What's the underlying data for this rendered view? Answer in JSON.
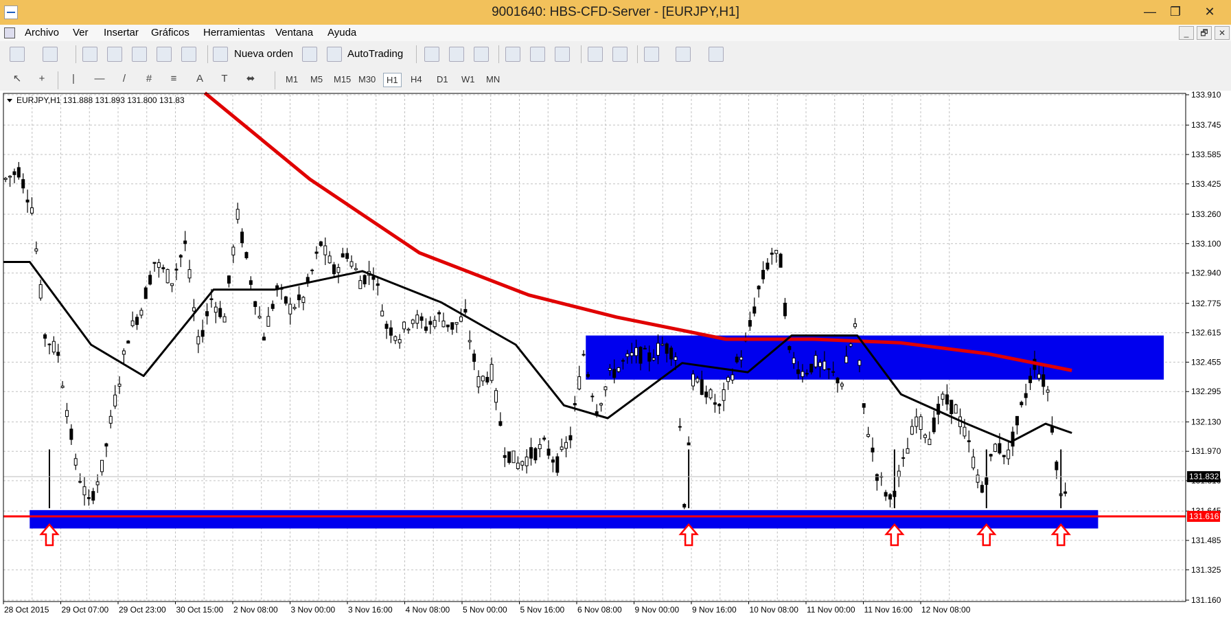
{
  "window": {
    "title": "9001640: HBS-CFD-Server - [EURJPY,H1]",
    "minimize": "—",
    "maximize": "❐",
    "close": "✕"
  },
  "menu": [
    "Archivo",
    "Ver",
    "Insertar",
    "Gráficos",
    "Herramientas",
    "Ventana",
    "Ayuda"
  ],
  "mdi": {
    "minimize": "_",
    "restore": "🗗",
    "close": "✕"
  },
  "toolbar": {
    "new_order": "Nueva orden",
    "autotrading": "AutoTrading",
    "search_placeholder": "",
    "search_icon": "🔍",
    "help_icon": "💬"
  },
  "drawing_tools": [
    "↖",
    "+",
    "|",
    "—",
    "/",
    "#",
    "≡",
    "A",
    "T",
    "⬌"
  ],
  "timeframes": [
    "M1",
    "M5",
    "M15",
    "M30",
    "H1",
    "H4",
    "D1",
    "W1",
    "MN"
  ],
  "active_timeframe": "H1",
  "colors": {
    "candles": "#000000",
    "ma_fast": "#000000",
    "ma_slow": "#e00000",
    "zone": "#0000ee",
    "support_line": "#ff0000",
    "grid": "#c0c0c0",
    "arrow": "#ff0000",
    "price_label_bg": "#000000",
    "line_label_bg": "#ff0000"
  },
  "chart_data": {
    "type": "candlestick",
    "header": "EURJPY,H1  131.888 131.893 131.800 131.83",
    "price_axis": [
      "133.910",
      "133.745",
      "133.585",
      "133.425",
      "133.260",
      "133.100",
      "132.940",
      "132.775",
      "132.615",
      "132.455",
      "132.295",
      "132.130",
      "131.970",
      "131.810",
      "131.645",
      "131.485",
      "131.325",
      "131.160"
    ],
    "ylim": [
      131.16,
      133.91
    ],
    "time_axis": [
      "28 Oct 2015",
      "29 Oct 07:00",
      "29 Oct 23:00",
      "30 Oct 15:00",
      "2 Nov 08:00",
      "3 Nov 00:00",
      "3 Nov 16:00",
      "4 Nov 08:00",
      "5 Nov 00:00",
      "5 Nov 16:00",
      "6 Nov 08:00",
      "9 Nov 00:00",
      "9 Nov 16:00",
      "10 Nov 08:00",
      "11 Nov 00:00",
      "11 Nov 16:00",
      "12 Nov 08:00"
    ],
    "current_price": "131.832",
    "support_price": "131.616",
    "price_series": [
      {
        "t": 0,
        "p": 133.45
      },
      {
        "t": 3,
        "p": 133.5
      },
      {
        "t": 6,
        "p": 133.3
      },
      {
        "t": 9,
        "p": 132.6
      },
      {
        "t": 12,
        "p": 132.5
      },
      {
        "t": 16,
        "p": 131.9
      },
      {
        "t": 19,
        "p": 131.68
      },
      {
        "t": 22,
        "p": 131.88
      },
      {
        "t": 25,
        "p": 132.25
      },
      {
        "t": 28,
        "p": 132.6
      },
      {
        "t": 31,
        "p": 132.75
      },
      {
        "t": 34,
        "p": 133.0
      },
      {
        "t": 38,
        "p": 132.9
      },
      {
        "t": 41,
        "p": 133.1
      },
      {
        "t": 44,
        "p": 132.55
      },
      {
        "t": 47,
        "p": 132.8
      },
      {
        "t": 50,
        "p": 132.7
      },
      {
        "t": 53,
        "p": 133.25
      },
      {
        "t": 56,
        "p": 132.9
      },
      {
        "t": 59,
        "p": 132.6
      },
      {
        "t": 62,
        "p": 132.85
      },
      {
        "t": 65,
        "p": 132.75
      },
      {
        "t": 68,
        "p": 132.8
      },
      {
        "t": 72,
        "p": 133.1
      },
      {
        "t": 75,
        "p": 132.95
      },
      {
        "t": 78,
        "p": 133.05
      },
      {
        "t": 81,
        "p": 132.9
      },
      {
        "t": 84,
        "p": 132.95
      },
      {
        "t": 87,
        "p": 132.65
      },
      {
        "t": 90,
        "p": 132.6
      },
      {
        "t": 93,
        "p": 132.7
      },
      {
        "t": 96,
        "p": 132.65
      },
      {
        "t": 99,
        "p": 132.7
      },
      {
        "t": 102,
        "p": 132.65
      },
      {
        "t": 105,
        "p": 132.7
      },
      {
        "t": 108,
        "p": 132.35
      },
      {
        "t": 111,
        "p": 132.4
      },
      {
        "t": 114,
        "p": 131.98
      },
      {
        "t": 117,
        "p": 131.9
      },
      {
        "t": 120,
        "p": 131.95
      },
      {
        "t": 123,
        "p": 132.0
      },
      {
        "t": 126,
        "p": 131.9
      },
      {
        "t": 129,
        "p": 132.05
      },
      {
        "t": 132,
        "p": 132.5
      },
      {
        "t": 135,
        "p": 132.2
      },
      {
        "t": 138,
        "p": 132.38
      },
      {
        "t": 141,
        "p": 132.45
      },
      {
        "t": 144,
        "p": 132.5
      },
      {
        "t": 147,
        "p": 132.48
      },
      {
        "t": 150,
        "p": 132.55
      },
      {
        "t": 153,
        "p": 132.5
      },
      {
        "t": 155,
        "p": 131.7
      },
      {
        "t": 157,
        "p": 132.35
      },
      {
        "t": 160,
        "p": 132.3
      },
      {
        "t": 163,
        "p": 132.2
      },
      {
        "t": 166,
        "p": 132.4
      },
      {
        "t": 169,
        "p": 132.55
      },
      {
        "t": 172,
        "p": 132.85
      },
      {
        "t": 175,
        "p": 133.05
      },
      {
        "t": 177,
        "p": 133.0
      },
      {
        "t": 179,
        "p": 132.5
      },
      {
        "t": 182,
        "p": 132.4
      },
      {
        "t": 185,
        "p": 132.45
      },
      {
        "t": 188,
        "p": 132.4
      },
      {
        "t": 191,
        "p": 132.35
      },
      {
        "t": 194,
        "p": 132.65
      },
      {
        "t": 196,
        "p": 132.2
      },
      {
        "t": 199,
        "p": 131.85
      },
      {
        "t": 202,
        "p": 131.7
      },
      {
        "t": 205,
        "p": 131.9
      },
      {
        "t": 208,
        "p": 132.15
      },
      {
        "t": 211,
        "p": 132.05
      },
      {
        "t": 214,
        "p": 132.25
      },
      {
        "t": 217,
        "p": 132.2
      },
      {
        "t": 220,
        "p": 132.0
      },
      {
        "t": 223,
        "p": 131.75
      },
      {
        "t": 226,
        "p": 132.0
      },
      {
        "t": 229,
        "p": 131.95
      },
      {
        "t": 232,
        "p": 132.2
      },
      {
        "t": 235,
        "p": 132.45
      },
      {
        "t": 238,
        "p": 132.3
      },
      {
        "t": 241,
        "p": 131.72
      },
      {
        "t": 243,
        "p": 131.82
      }
    ],
    "series": [
      {
        "role": "ma_slow",
        "points": [
          {
            "t": 46,
            "p": 133.92
          },
          {
            "t": 70,
            "p": 133.45
          },
          {
            "t": 95,
            "p": 133.05
          },
          {
            "t": 120,
            "p": 132.82
          },
          {
            "t": 140,
            "p": 132.7
          },
          {
            "t": 165,
            "p": 132.58
          },
          {
            "t": 185,
            "p": 132.58
          },
          {
            "t": 205,
            "p": 132.56
          },
          {
            "t": 225,
            "p": 132.5
          },
          {
            "t": 244,
            "p": 132.41
          }
        ]
      },
      {
        "role": "ma_fast",
        "points": [
          {
            "t": 0,
            "p": 133.0
          },
          {
            "t": 6,
            "p": 133.0
          },
          {
            "t": 20,
            "p": 132.55
          },
          {
            "t": 32,
            "p": 132.38
          },
          {
            "t": 48,
            "p": 132.85
          },
          {
            "t": 62,
            "p": 132.85
          },
          {
            "t": 82,
            "p": 132.95
          },
          {
            "t": 100,
            "p": 132.78
          },
          {
            "t": 117,
            "p": 132.55
          },
          {
            "t": 128,
            "p": 132.22
          },
          {
            "t": 138,
            "p": 132.15
          },
          {
            "t": 155,
            "p": 132.45
          },
          {
            "t": 170,
            "p": 132.4
          },
          {
            "t": 180,
            "p": 132.6
          },
          {
            "t": 195,
            "p": 132.6
          },
          {
            "t": 205,
            "p": 132.28
          },
          {
            "t": 220,
            "p": 132.12
          },
          {
            "t": 230,
            "p": 132.02
          },
          {
            "t": 238,
            "p": 132.12
          },
          {
            "t": 244,
            "p": 132.07
          }
        ]
      }
    ],
    "zones": [
      {
        "t_start": 133,
        "t_end": 265,
        "p_top": 132.6,
        "p_bottom": 132.36
      },
      {
        "t_start": 6,
        "t_end": 250,
        "p_top": 131.65,
        "p_bottom": 131.55
      }
    ],
    "support_line": 131.616,
    "arrows_at_t": [
      10,
      156,
      203,
      224,
      241
    ],
    "grid": true
  }
}
